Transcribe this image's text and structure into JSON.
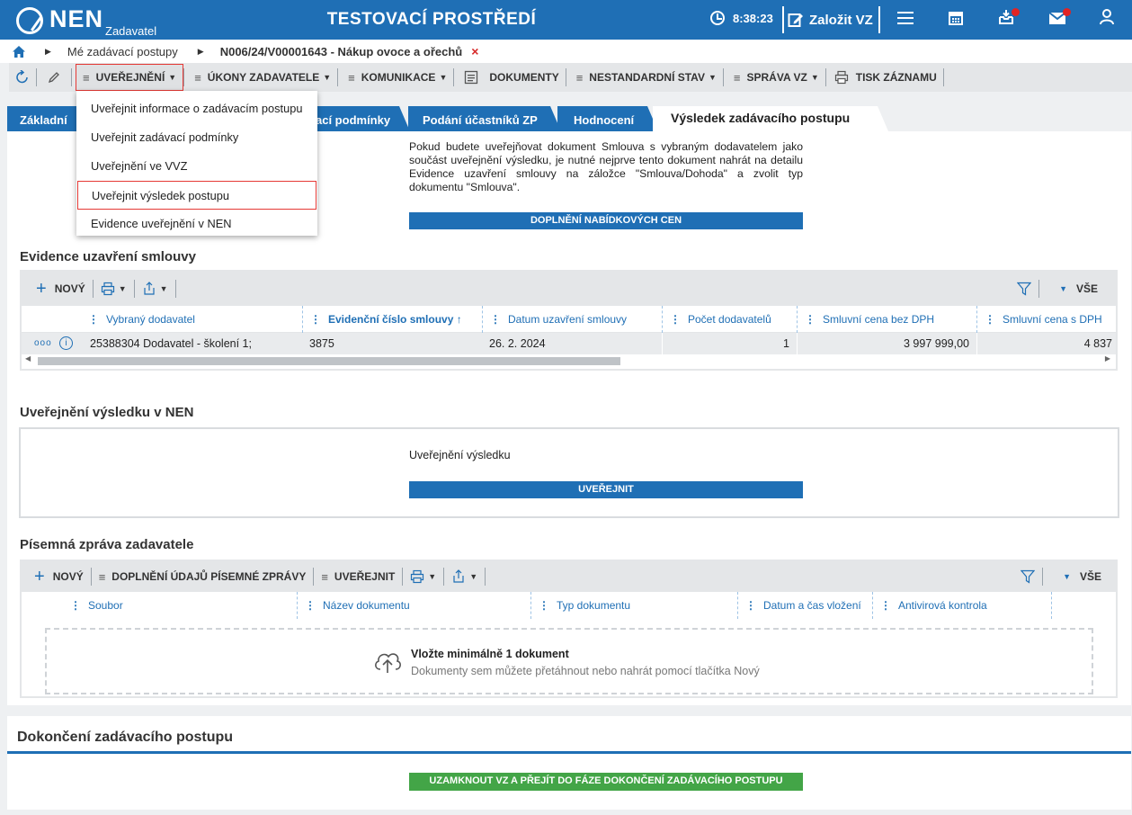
{
  "header": {
    "logo": "NEN",
    "logo_sub": "Zadavatel",
    "title": "TESTOVACÍ PROSTŘEDÍ",
    "time": "8:38:23",
    "create_vz": "Založit VZ",
    "icons": [
      "menu-icon",
      "calendar-icon",
      "inbox-icon",
      "mail-icon",
      "user-icon"
    ]
  },
  "breadcrumb": {
    "home_icon": "home-icon",
    "items": [
      "Mé zadávací postupy",
      "N006/24/V00001643 - Nákup ovoce a ořechů"
    ],
    "close": "×"
  },
  "toolbar": {
    "uverejneni": "UVEŘEJNĚNÍ",
    "ukony": "ÚKONY ZADAVATELE",
    "komunikace": "KOMUNIKACE",
    "dokumenty": "DOKUMENTY",
    "nestandardni": "NESTANDARDNÍ STAV",
    "sprava": "SPRÁVA VZ",
    "tisk": "TISK ZÁZNAMU"
  },
  "dropdown": {
    "items": [
      "Uveřejnit informace o zadávacím postupu",
      "Uveřejnit zadávací podmínky",
      "Uveřejnění ve VVZ",
      "Uveřejnit výsledek postupu",
      "Evidence uveřejnění v NEN"
    ],
    "highlighted_index": 3
  },
  "tabs": [
    {
      "label": "Základní"
    },
    {
      "label": "ací podmínky"
    },
    {
      "label": "Podání účastníků ZP"
    },
    {
      "label": "Hodnocení"
    },
    {
      "label": "Výsledek zadávacího postupu",
      "active": true
    }
  ],
  "info": {
    "text": "Pokud budete uveřejňovat dokument Smlouva s vybraným dodavatelem jako součást uveřejnění výsledku, je nutné nejprve tento dokument nahrát na detailu Evidence uzavření smlouvy na záložce \"Smlouva/Dohoda\" a zvolit typ dokumentu \"Smlouva\".",
    "button": "DOPLNĚNÍ NABÍDKOVÝCH CEN"
  },
  "evidence": {
    "title": "Evidence uzavření smlouvy",
    "new_label": "NOVÝ",
    "filter_all": "VŠE",
    "columns": [
      "Vybraný dodavatel",
      "Evidenční číslo smlouvy",
      "Datum uzavření smlouvy",
      "Počet dodavatelů",
      "Smluvní cena bez DPH",
      "Smluvní cena s DPH"
    ],
    "sort_arrow": "↑",
    "row": {
      "supplier": "25388304 Dodavatel - školení 1;",
      "contract_no": "3875",
      "date": "26. 2. 2024",
      "count": "1",
      "price_no_vat": "3 997 999,00",
      "price_vat": "4 837"
    }
  },
  "publication": {
    "title": "Uveřejnění výsledku v NEN",
    "label": "Uveřejnění výsledku",
    "button": "UVEŘEJNIT"
  },
  "report": {
    "title": "Písemná zpráva zadavatele",
    "new_label": "NOVÝ",
    "fill_label": "DOPLNĚNÍ ÚDAJŮ PÍSEMNÉ ZPRÁVY",
    "publish_label": "UVEŘEJNIT",
    "filter_all": "VŠE",
    "columns": [
      "Soubor",
      "Název dokumentu",
      "Typ dokumentu",
      "Datum a čas vložení",
      "Antivirová kontrola"
    ],
    "upload_title": "Vložte minimálně 1 dokument",
    "upload_hint": "Dokumenty sem můžete přetáhnout nebo nahrát pomocí tlačítka Nový"
  },
  "completion": {
    "title": "Dokončení zadávacího postupu",
    "button": "UZAMKNOUT VZ A PŘEJÍT DO FÁZE DOKONČENÍ ZADÁVACÍHO POSTUPU"
  },
  "colors": {
    "brand_blue": "#1f6fb5",
    "green": "#43a547",
    "highlight_red": "#e53935"
  }
}
